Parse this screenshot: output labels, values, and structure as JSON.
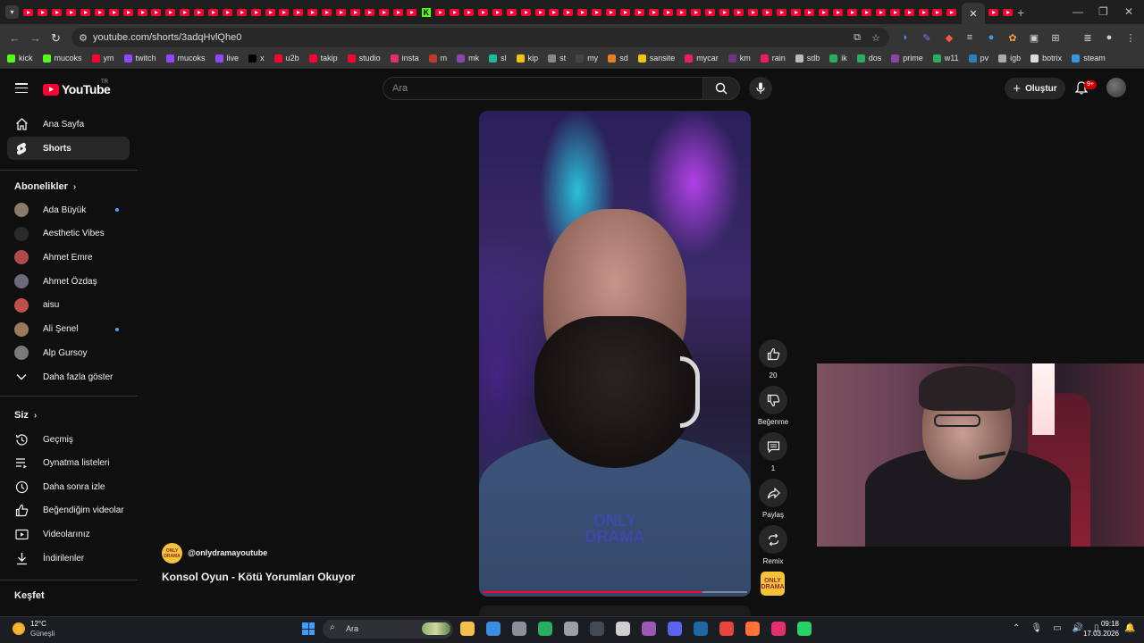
{
  "browser": {
    "url": "youtube.com/shorts/3adqHvlQhe0",
    "bookmarks": [
      {
        "label": "kick",
        "color": "#53fc18"
      },
      {
        "label": "mucoks",
        "color": "#53fc18"
      },
      {
        "label": "ym",
        "color": "#ff0033"
      },
      {
        "label": "twitch",
        "color": "#9146ff"
      },
      {
        "label": "mucoks",
        "color": "#9146ff"
      },
      {
        "label": "live",
        "color": "#9146ff"
      },
      {
        "label": "x",
        "color": "#000000"
      },
      {
        "label": "u2b",
        "color": "#ff0033"
      },
      {
        "label": "takip",
        "color": "#ff0033"
      },
      {
        "label": "studio",
        "color": "#ff0033"
      },
      {
        "label": "insta",
        "color": "#e1306c"
      },
      {
        "label": "m",
        "color": "#c0392b"
      },
      {
        "label": "mk",
        "color": "#8e44ad"
      },
      {
        "label": "sl",
        "color": "#1abc9c"
      },
      {
        "label": "kip",
        "color": "#f1c40f"
      },
      {
        "label": "st",
        "color": "#888888"
      },
      {
        "label": "my",
        "color": "#444444"
      },
      {
        "label": "sd",
        "color": "#e67e22"
      },
      {
        "label": "sansite",
        "color": "#f1c40f"
      },
      {
        "label": "mycar",
        "color": "#e91e63"
      },
      {
        "label": "km",
        "color": "#6c3483"
      },
      {
        "label": "rain",
        "color": "#e91e63"
      },
      {
        "label": "sdb",
        "color": "#bbbbbb"
      },
      {
        "label": "ik",
        "color": "#27ae60"
      },
      {
        "label": "dos",
        "color": "#27ae60"
      },
      {
        "label": "prime",
        "color": "#8e44ad"
      },
      {
        "label": "w11",
        "color": "#27ae60"
      },
      {
        "label": "pv",
        "color": "#2980b9"
      },
      {
        "label": "igb",
        "color": "#aaaaaa"
      },
      {
        "label": "botrix",
        "color": "#dddddd"
      },
      {
        "label": "steam",
        "color": "#3498db"
      }
    ]
  },
  "header": {
    "logo_text": "YouTube",
    "country": "TR",
    "search_placeholder": "Ara",
    "create_label": "Oluştur",
    "notifications": "9+"
  },
  "sidebar": {
    "main": [
      {
        "label": "Ana Sayfa",
        "icon": "home-icon",
        "active": false
      },
      {
        "label": "Shorts",
        "icon": "shorts-icon",
        "active": true
      }
    ],
    "subscriptions_title": "Abonelikler",
    "subscriptions": [
      {
        "label": "Ada Büyük",
        "color": "#8a7a6a",
        "new": true
      },
      {
        "label": "Aesthetic Vibes",
        "color": "#2b2b2b",
        "new": false
      },
      {
        "label": "Ahmet Emre",
        "color": "#b04a4a",
        "new": false
      },
      {
        "label": "Ahmet Özdaş",
        "color": "#6a6a7a",
        "new": false
      },
      {
        "label": "aisu",
        "color": "#c0504a",
        "new": false
      },
      {
        "label": "Ali Şenel",
        "color": "#9a7a5a",
        "new": true
      },
      {
        "label": "Alp Gursoy",
        "color": "#7a7a7a",
        "new": false
      }
    ],
    "show_more": "Daha fazla göster",
    "you_title": "Siz",
    "you_items": [
      {
        "label": "Geçmiş",
        "icon": "history-icon"
      },
      {
        "label": "Oynatma listeleri",
        "icon": "playlists-icon"
      },
      {
        "label": "Daha sonra izle",
        "icon": "watch-later-icon"
      },
      {
        "label": "Beğendiğim videolar",
        "icon": "liked-videos-icon"
      },
      {
        "label": "Videolarınız",
        "icon": "your-videos-icon"
      },
      {
        "label": "İndirilenler",
        "icon": "downloads-icon"
      }
    ],
    "explore_title": "Keşfet"
  },
  "short": {
    "watermark": "ONLY DRAMA",
    "progress": 0.83,
    "likes": "20",
    "dislike_label": "Beğenme",
    "comments": "1",
    "share_label": "Paylaş",
    "remix_label": "Remix",
    "channel_handle": "@onlydramayoutube",
    "channel_avatar_text": "ONLY DRAMA",
    "title": "Konsol Oyun - Kötü Yorumları Okuyor"
  },
  "taskbar": {
    "weather_temp": "12°C",
    "weather_cond": "Güneşli",
    "search_label": "Ara",
    "time": "09:18",
    "date": "17.03.2026",
    "apps": [
      {
        "name": "file-explorer-icon",
        "color": "#f3c14b"
      },
      {
        "name": "store-icon",
        "color": "#3a8fe0"
      },
      {
        "name": "settings-icon",
        "color": "#8a8f99"
      },
      {
        "name": "headset-app-icon",
        "color": "#27ae60"
      },
      {
        "name": "steam-helper-icon",
        "color": "#9aa0a8"
      },
      {
        "name": "obs-icon",
        "color": "#444a55"
      },
      {
        "name": "kick-app-icon",
        "color": "#cfcfcf"
      },
      {
        "name": "purple-app-icon",
        "color": "#9b59b6"
      },
      {
        "name": "discord-icon",
        "color": "#5865f2"
      },
      {
        "name": "steam-icon",
        "color": "#1b6aa5"
      },
      {
        "name": "chrome-icon",
        "color": "#e8453c"
      },
      {
        "name": "firefox-icon",
        "color": "#ff7139"
      },
      {
        "name": "instagram-icon",
        "color": "#e1306c"
      },
      {
        "name": "whatsapp-icon",
        "color": "#25d366"
      }
    ]
  }
}
